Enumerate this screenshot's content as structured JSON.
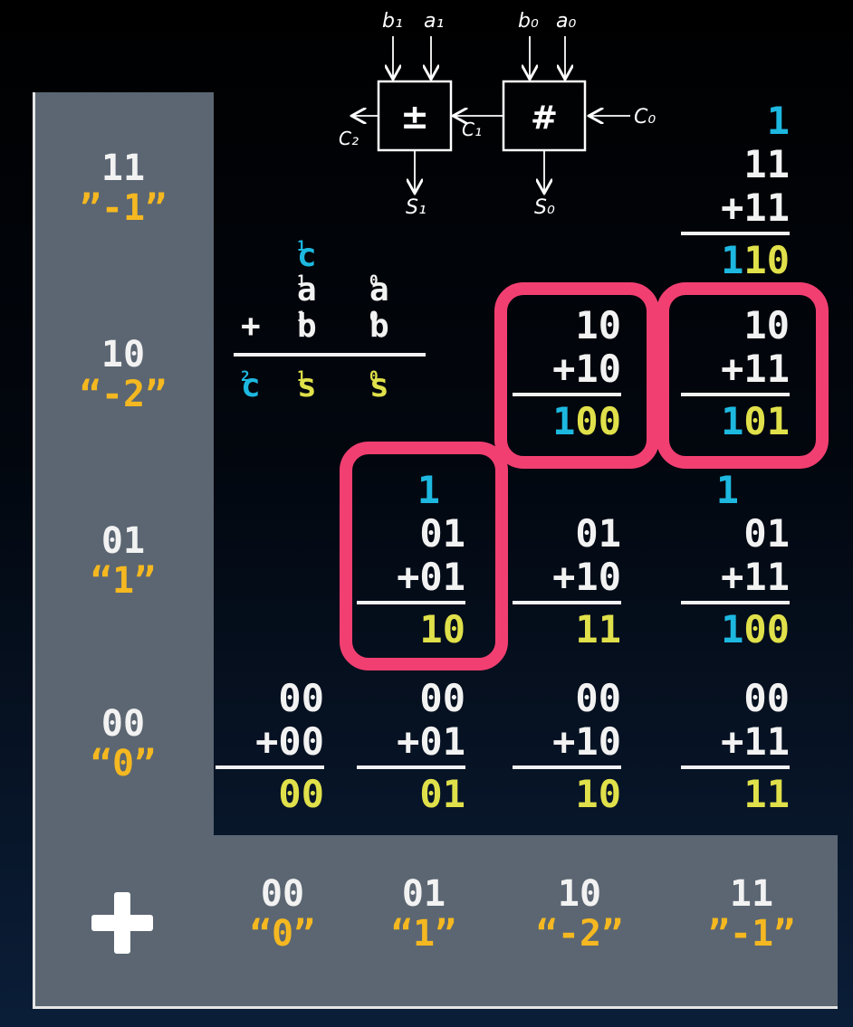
{
  "diagram": {
    "operator": "+",
    "rows": [
      {
        "binary": "11",
        "value": "”-1”"
      },
      {
        "binary": "10",
        "value": "“-2”"
      },
      {
        "binary": "01",
        "value": "“1”"
      },
      {
        "binary": "00",
        "value": "“0”"
      }
    ],
    "cols": [
      {
        "binary": "00",
        "value": "“0”"
      },
      {
        "binary": "01",
        "value": "“1”"
      },
      {
        "binary": "10",
        "value": "“-2”"
      },
      {
        "binary": "11",
        "value": "”-1”"
      }
    ],
    "cells": {
      "r11c11": {
        "carry": "1",
        "a": "11",
        "b": "+11",
        "result_carry": "1",
        "result": "10"
      },
      "r10c10": {
        "carry": "",
        "a": "10",
        "b": "+10",
        "result_carry": "1",
        "result": "00"
      },
      "r10c11": {
        "carry": "",
        "a": "10",
        "b": "+11",
        "result_carry": "1",
        "result": "01"
      },
      "r01c01": {
        "carry": "1",
        "a": "01",
        "b": "+01",
        "result_carry": "",
        "result": "10"
      },
      "r01c10": {
        "carry": "",
        "a": "01",
        "b": "+10",
        "result_carry": "",
        "result": "11"
      },
      "r01c11": {
        "carry": "1",
        "a": "01",
        "b": "+11",
        "result_carry": "1",
        "result": "00"
      },
      "r00c00": {
        "carry": "",
        "a": "00",
        "b": "+00",
        "result_carry": "",
        "result": "00"
      },
      "r00c01": {
        "carry": "",
        "a": "00",
        "b": "+01",
        "result_carry": "",
        "result": "01"
      },
      "r00c10": {
        "carry": "",
        "a": "00",
        "b": "+10",
        "result_carry": "",
        "result": "10"
      },
      "r00c11": {
        "carry": "",
        "a": "00",
        "b": "+11",
        "result_carry": "",
        "result": "11"
      }
    },
    "legend": {
      "c1": "c",
      "c1_sub": "1",
      "a1": "a",
      "a1_sub": "1",
      "a0": "a",
      "a0_sub": "0",
      "plus": "+",
      "b1": "b",
      "b1_sub": "1",
      "b0": "b",
      "b0_sub": "0",
      "c2": "c",
      "c2_sub": "2",
      "s1": "s",
      "s1_sub": "1",
      "s0": "s",
      "s0_sub": "0"
    },
    "circuit": {
      "block1_symbol": "±",
      "block0_symbol": "#",
      "b1": "b₁",
      "a1": "a₁",
      "b0": "b₀",
      "a0": "a₀",
      "c0": "C₀",
      "c1": "C₁",
      "c2": "C₂",
      "s1": "S₁",
      "s0": "S₀"
    },
    "colors": {
      "panel": "#5b6672",
      "highlight": "#f23f72",
      "carry": "#1db8e0",
      "sum": "#e0e04a",
      "label": "#f5b820",
      "text": "#f2f2f2"
    }
  }
}
